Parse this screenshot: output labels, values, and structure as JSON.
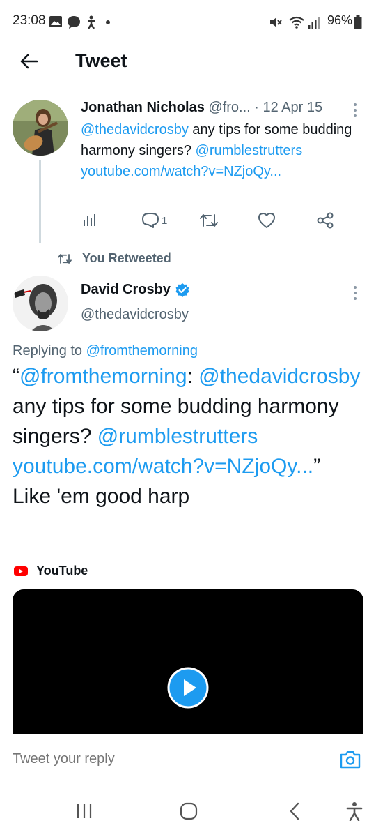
{
  "status_bar": {
    "time": "23:08",
    "battery": "96%",
    "icons": [
      "gallery-icon",
      "message-icon",
      "accessibility-icon",
      "dot-icon",
      "mute-icon",
      "wifi-icon",
      "signal-icon",
      "battery-icon"
    ]
  },
  "header": {
    "back_icon": "back-arrow-icon",
    "title": "Tweet"
  },
  "tweet1": {
    "name": "Jonathan Nicholas",
    "handle": "@fro...",
    "separator": "·",
    "date": "12 Apr 15",
    "mention1": "@thedavidcrosby",
    "text": " any tips for some budding harmony singers? ",
    "mention2": "@rumblestrutters",
    "link": " youtube.com/watch?v=NZjoQy...",
    "reply_count": "1",
    "actions": [
      "analytics-icon",
      "reply-icon",
      "retweet-icon",
      "like-icon",
      "share-icon"
    ]
  },
  "retweet_label": "You Retweeted",
  "tweet2": {
    "name": "David Crosby",
    "verified": true,
    "handle": "@thedavidcrosby",
    "replying_prefix": "Replying to ",
    "replying_handle": "@fromthemorning",
    "quote_open": "“",
    "q_mention1": "@fromthemorning",
    "q_colon": ":",
    "q_mention2": "@thedavidcrosby",
    "q_text": " any tips for some budding harmony singers? ",
    "q_mention3": "@rumblestrutters",
    "q_link": " youtube.com/watch?v=NZjoQy...",
    "quote_close": "”",
    "text": "Like 'em good harp",
    "media_source": "YouTube"
  },
  "reply_bar": {
    "placeholder": "Tweet your reply",
    "camera_icon": "camera-icon"
  },
  "nav_bar": [
    "recents-icon",
    "home-icon",
    "back-icon",
    "accessibility-icon"
  ],
  "colors": {
    "link": "#1d9bf0",
    "secondary": "#536471",
    "youtube_red": "#ff0000"
  }
}
